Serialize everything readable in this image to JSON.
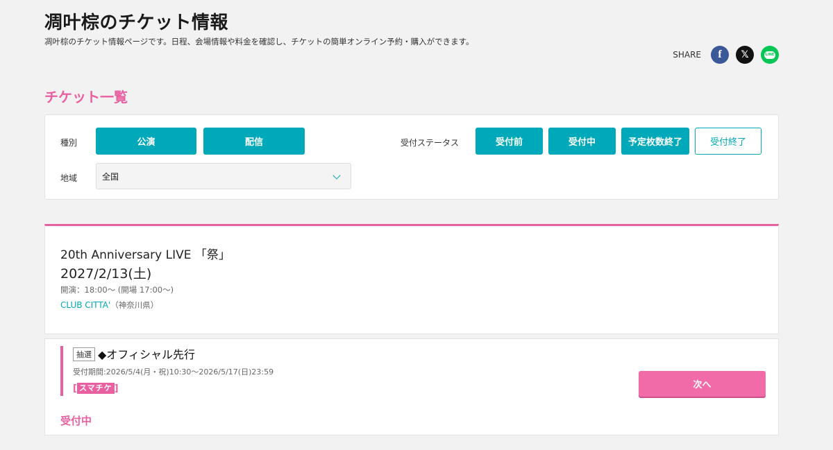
{
  "header": {
    "title": "凋叶棕のチケット情報",
    "description": "凋叶棕のチケット情報ページです。日程、会場情報や料金を確認し、チケットの簡単オンライン予約・購入ができます。"
  },
  "share": {
    "label": "SHARE",
    "facebook_glyph": "f",
    "x_glyph": "𝕏",
    "line_glyph": "LINE"
  },
  "ticket_list": {
    "title": "チケット一覧"
  },
  "filters": {
    "type_label": "種別",
    "type_options": [
      "公演",
      "配信"
    ],
    "status_label": "受付ステータス",
    "status_options": [
      "受付前",
      "受付中",
      "予定枚数終了",
      "受付終了"
    ],
    "region_label": "地域",
    "region_value": "全国"
  },
  "event": {
    "title": "20th Anniversary LIVE 「祭」",
    "date": "2027/2/13(土)",
    "time": "開演：18:00～ (開場 17:00～)",
    "venue": "CLUB CITTA'",
    "prefecture": "（神奈川県）"
  },
  "ticket": {
    "badge": "抽選",
    "name": "◆オフィシャル先行",
    "period": "受付期間:2026/5/4(月・祝)10:30～2026/5/17(日)23:59",
    "logo_text": "スマチケ",
    "next_button": "次へ",
    "status": "受付中"
  },
  "colors": {
    "accent_pink": "#e8609f",
    "teal": "#00a9b9"
  }
}
